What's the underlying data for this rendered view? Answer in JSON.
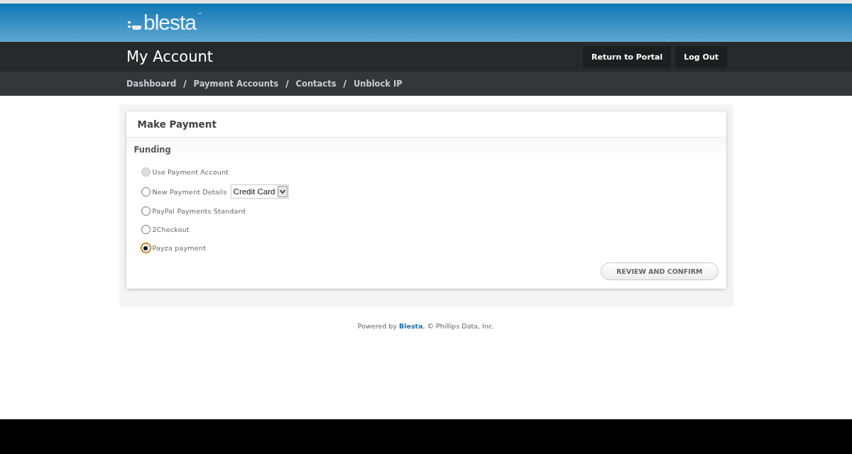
{
  "header": {
    "logo_text": "blesta",
    "trademark": "™"
  },
  "title_bar": {
    "title": "My Account",
    "buttons": [
      "Return to Portal",
      "Log Out"
    ]
  },
  "nav": {
    "items": [
      "Dashboard",
      "Payment Accounts",
      "Contacts",
      "Unblock IP"
    ],
    "separator": "/"
  },
  "panel": {
    "title": "Make Payment",
    "section": "Funding",
    "options": [
      {
        "kind": "plain",
        "label": "Use Payment Account",
        "selected": false,
        "disabled": true
      },
      {
        "kind": "select",
        "label": "New Payment Details",
        "selected": false,
        "disabled": false,
        "select_value": "Credit Card"
      },
      {
        "kind": "plain",
        "label": "PayPal Payments Standard",
        "selected": false,
        "disabled": false
      },
      {
        "kind": "plain",
        "label": "2Checkout",
        "selected": false,
        "disabled": false
      },
      {
        "kind": "plain",
        "label": "Payza payment",
        "selected": true,
        "disabled": false
      }
    ],
    "submit": "REVIEW AND CONFIRM"
  },
  "footer": {
    "before": "Powered by ",
    "link": "Blesta",
    "after": ", © Phillips Data, Inc."
  }
}
